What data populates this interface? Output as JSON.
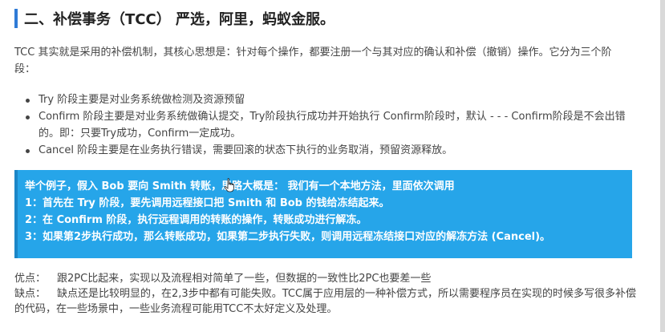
{
  "heading": {
    "title": "二、补偿事务（TCC） 严选，阿里，蚂蚁金服。"
  },
  "intro": {
    "text": "TCC 其实就是采用的补偿机制，其核心思想是：针对每个操作，都要注册一个与其对应的确认和补偿（撤销）操作。它分为三个阶段："
  },
  "bullets": [
    "Try 阶段主要是对业务系统做检测及资源预留",
    "Confirm 阶段主要是对业务系统做确认提交，Try阶段执行成功并开始执行 Confirm阶段时，默认 - - - Confirm阶段是不会出错的。即：只要Try成功，Confirm一定成功。",
    "Cancel 阶段主要是在业务执行错误，需要回滚的状态下执行的业务取消，预留资源释放。"
  ],
  "callout": {
    "lines": [
      "举个例子，假入 Bob 要向 Smith 转账，思路大概是：  我们有一个本地方法，里面依次调用",
      "1：首先在 Try 阶段，要先调用远程接口把 Smith 和 Bob 的钱给冻结起来。",
      "2：在 Confirm 阶段，执行远程调用的转账的操作，转账成功进行解冻。",
      "3：如果第2步执行成功，那么转账成功，如果第二步执行失败，则调用远程冻结接口对应的解冻方法 (Cancel)。"
    ]
  },
  "footer": {
    "pros_label": "优点：",
    "pros_text": "跟2PC比起来，实现以及流程相对简单了一些，但数据的一致性比2PC也要差一些",
    "cons_label": "缺点：",
    "cons_text": "缺点还是比较明显的，在2,3步中都有可能失败。TCC属于应用层的一种补偿方式，所以需要程序员在实现的时候多写很多补偿的代码，在一些场景中，一些业务流程可能用TCC不太好定义及处理。"
  },
  "colors": {
    "accent_bar": "#2f7bd6",
    "callout_bg": "#26a5e9",
    "callout_text": "#ffffff"
  }
}
